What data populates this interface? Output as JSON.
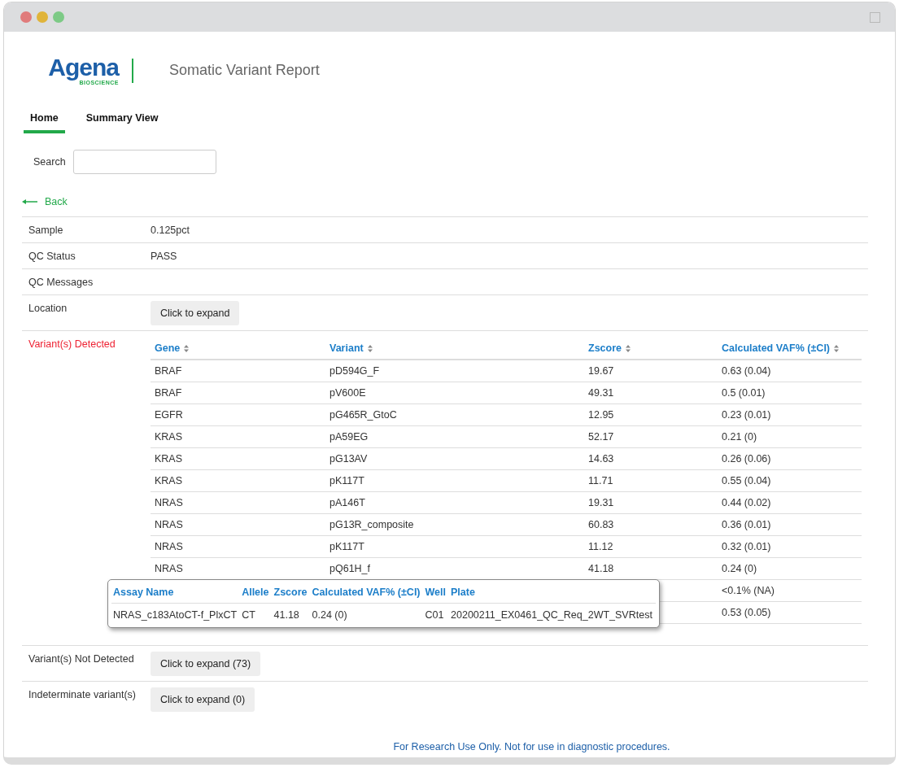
{
  "logo": {
    "name": "Agena",
    "sub": "BIOSCIENCE"
  },
  "title": "Somatic Variant Report",
  "tabs": [
    {
      "label": "Home",
      "selected": true
    },
    {
      "label": "Summary View",
      "selected": false
    }
  ],
  "search": {
    "label": "Search"
  },
  "back": "Back",
  "details": [
    {
      "label": "Sample",
      "kind": "text",
      "value": "0.125pct"
    },
    {
      "label": "QC Status",
      "kind": "text",
      "value": "PASS"
    },
    {
      "label": "QC Messages",
      "kind": "text"
    },
    {
      "label": "Location",
      "kind": "button",
      "value": "Click to expand"
    },
    {
      "label": "Variant(s) Detected",
      "kind": "table"
    },
    {
      "label": "Variant(s) Not Detected",
      "kind": "button",
      "value": "Click to expand (73)"
    },
    {
      "label": "Indeterminate variant(s)",
      "kind": "button",
      "value": "Click to expand (0)"
    }
  ],
  "variants": {
    "columns": [
      "Gene",
      "Variant",
      "Zscore",
      "Calculated VAF% (±CI)"
    ],
    "rows": [
      {
        "gene": "BRAF",
        "variant": "pD594G_F",
        "zscore": "19.67",
        "vaf": "0.63 (0.04)"
      },
      {
        "gene": "BRAF",
        "variant": "pV600E",
        "zscore": "49.31",
        "vaf": "0.5 (0.01)"
      },
      {
        "gene": "EGFR",
        "variant": "pG465R_GtoC",
        "zscore": "12.95",
        "vaf": "0.23 (0.01)"
      },
      {
        "gene": "KRAS",
        "variant": "pA59EG",
        "zscore": "52.17",
        "vaf": "0.21 (0)"
      },
      {
        "gene": "KRAS",
        "variant": "pG13AV",
        "zscore": "14.63",
        "vaf": "0.26 (0.06)"
      },
      {
        "gene": "KRAS",
        "variant": "pK117T",
        "zscore": "11.71",
        "vaf": "0.55 (0.04)"
      },
      {
        "gene": "NRAS",
        "variant": "pA146T",
        "zscore": "19.31",
        "vaf": "0.44 (0.02)"
      },
      {
        "gene": "NRAS",
        "variant": "pG13R_composite",
        "zscore": "60.83",
        "vaf": "0.36 (0.01)"
      },
      {
        "gene": "NRAS",
        "variant": "pK117T",
        "zscore": "11.12",
        "vaf": "0.32 (0.01)"
      },
      {
        "gene": "NRAS",
        "variant": "pQ61H_f",
        "zscore": "41.18",
        "vaf": "0.24 (0)"
      },
      {
        "vaf": "<0.1% (NA)"
      },
      {
        "vaf": "0.53 (0.05)"
      }
    ]
  },
  "tooltip": {
    "columns": [
      "Assay Name",
      "Allele",
      "Zscore",
      "Calculated VAF% (±CI)",
      "Well",
      "Plate"
    ],
    "rows": [
      [
        "NRAS_c183AtoCT-f_PlxCT",
        "CT",
        "41.18",
        "0.24 (0)",
        "C01",
        "20200211_EX0461_QC_Req_2WT_SVRtest"
      ]
    ]
  },
  "footer": "For Research Use Only. Not for use in diagnostic procedures."
}
